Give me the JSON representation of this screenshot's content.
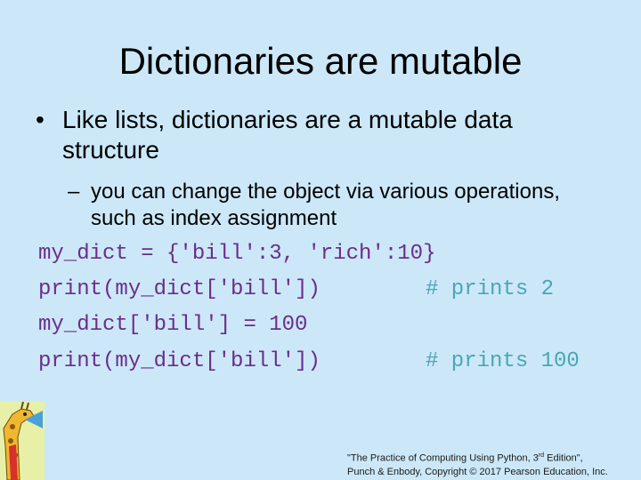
{
  "title": "Dictionaries are mutable",
  "bullet": {
    "marker": "•",
    "text": "Like lists, dictionaries are a mutable data structure"
  },
  "sub_bullet": {
    "marker": "–",
    "text": "you can change the object via various operations, such as index assignment"
  },
  "code": [
    {
      "code": "my_dict = {'bill':3, 'rich':10}",
      "comment": ""
    },
    {
      "code": "print(my_dict['bill'])",
      "comment": "# prints 2"
    },
    {
      "code": "my_dict['bill'] = 100",
      "comment": ""
    },
    {
      "code": "print(my_dict['bill'])",
      "comment": "# prints 100"
    }
  ],
  "footer": {
    "line1_a": "\"The Practice of Computing Using Python, 3",
    "line1_sup": "rd",
    "line1_b": " Edition\",",
    "line2": "Punch & Enbody, Copyright © 2017 Pearson Education, Inc."
  },
  "colors": {
    "background": "#cce8f8",
    "code": "#6a2d8a",
    "comment": "#4aa6b4"
  },
  "logo_icon": "giraffe-icon"
}
